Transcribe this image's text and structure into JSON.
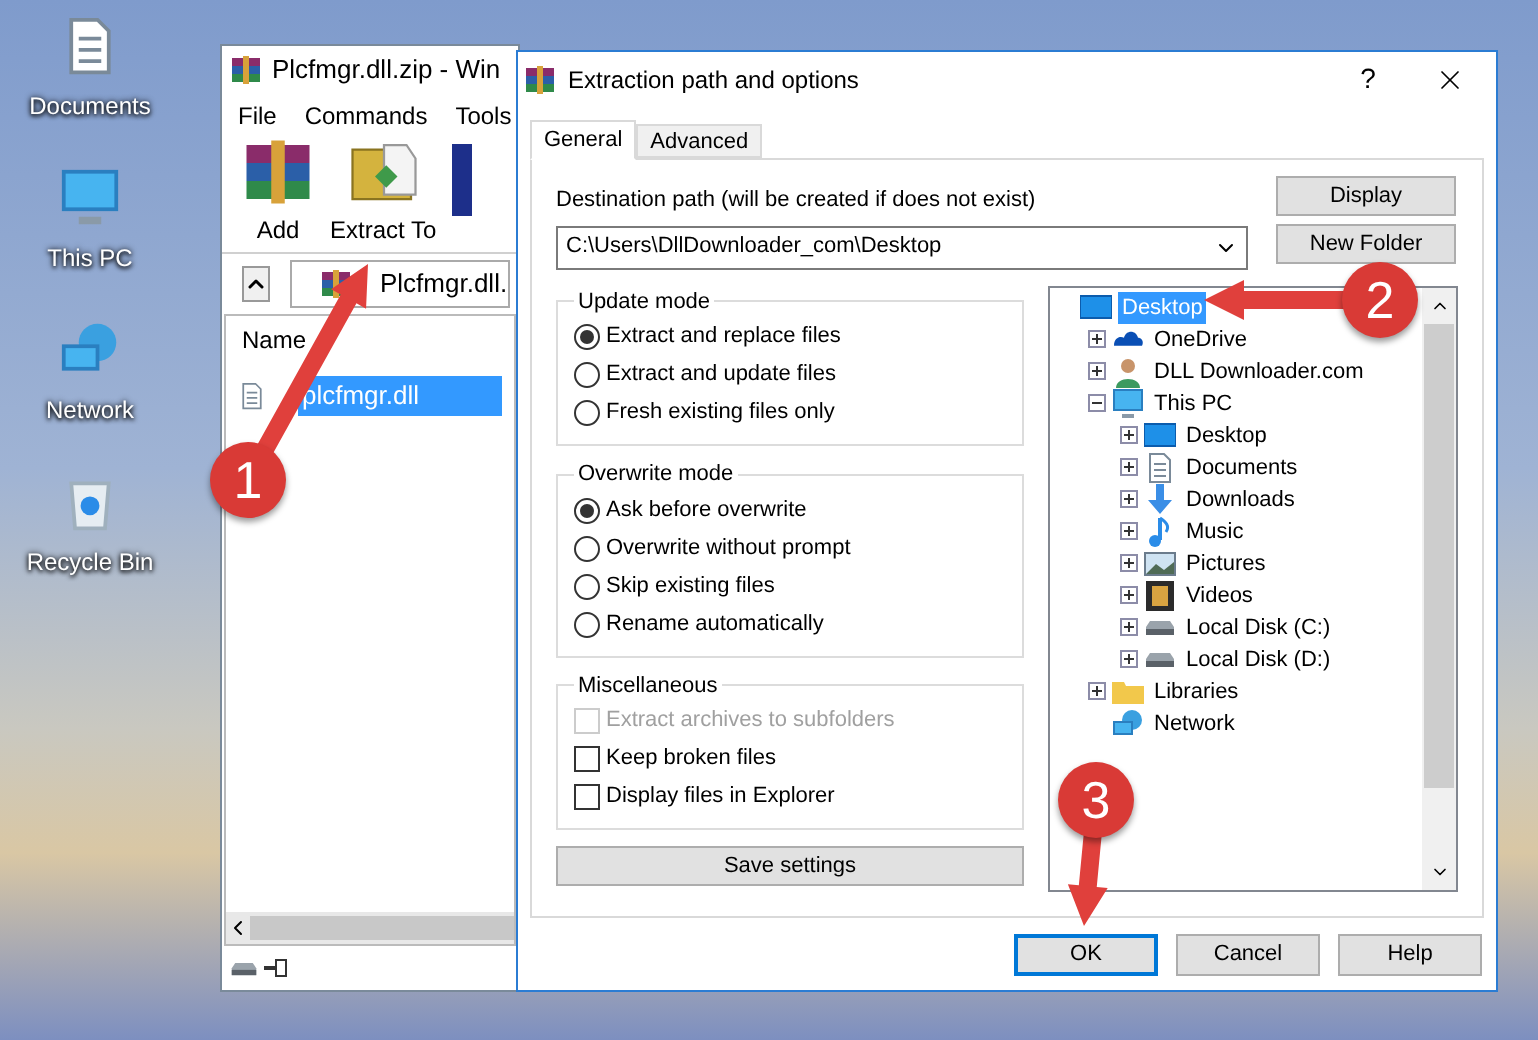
{
  "desktop_icons": [
    {
      "label": "Documents",
      "kind": "documents"
    },
    {
      "label": "This PC",
      "kind": "pc"
    },
    {
      "label": "Network",
      "kind": "network"
    },
    {
      "label": "Recycle Bin",
      "kind": "recycle"
    }
  ],
  "archive_window": {
    "title": "Plcfmgr.dll.zip - Win",
    "menu": [
      "File",
      "Commands",
      "Tools"
    ],
    "toolbar": [
      {
        "label": "Add",
        "kind": "add"
      },
      {
        "label": "Extract To",
        "kind": "extract"
      }
    ],
    "path": "Plcfmgr.dll.",
    "column": "Name",
    "files": [
      {
        "name": "plcfmgr.dll",
        "selected": true
      }
    ]
  },
  "dialog": {
    "title": "Extraction path and options",
    "help": "?",
    "tabs": [
      {
        "label": "General",
        "selected": true
      },
      {
        "label": "Advanced",
        "selected": false
      }
    ],
    "destination": {
      "label": "Destination path (will be created if does not exist)",
      "value": "C:\\Users\\DllDownloader_com\\Desktop"
    },
    "side_buttons": [
      "Display",
      "New Folder"
    ],
    "groups": [
      {
        "title": "Update mode",
        "kind": "radio",
        "options": [
          {
            "label": "Extract and replace files",
            "selected": true
          },
          {
            "label": "Extract and update files",
            "selected": false
          },
          {
            "label": "Fresh existing files only",
            "selected": false
          }
        ]
      },
      {
        "title": "Overwrite mode",
        "kind": "radio",
        "options": [
          {
            "label": "Ask before overwrite",
            "selected": true
          },
          {
            "label": "Overwrite without prompt",
            "selected": false
          },
          {
            "label": "Skip existing files",
            "selected": false
          },
          {
            "label": "Rename automatically",
            "selected": false
          }
        ]
      },
      {
        "title": "Miscellaneous",
        "kind": "check",
        "options": [
          {
            "label": "Extract archives to subfolders",
            "checked": false,
            "disabled": true
          },
          {
            "label": "Keep broken files",
            "checked": false,
            "disabled": false
          },
          {
            "label": "Display files in Explorer",
            "checked": false,
            "disabled": false
          }
        ]
      }
    ],
    "save_button": "Save settings",
    "tree": [
      {
        "label": "Desktop",
        "kind": "desktop",
        "selected": true,
        "children": [
          {
            "label": "OneDrive",
            "kind": "cloud",
            "selected": false,
            "expanded": false
          },
          {
            "label": "DLL Downloader.com",
            "kind": "user",
            "selected": false,
            "expanded": false
          },
          {
            "label": "This PC",
            "kind": "pc",
            "selected": false,
            "expanded": true,
            "children": [
              {
                "label": "Desktop",
                "kind": "desktop",
                "selected": false,
                "expanded": false
              },
              {
                "label": "Documents",
                "kind": "documents",
                "selected": false,
                "expanded": false
              },
              {
                "label": "Downloads",
                "kind": "download",
                "selected": false,
                "expanded": false
              },
              {
                "label": "Music",
                "kind": "music",
                "selected": false,
                "expanded": false
              },
              {
                "label": "Pictures",
                "kind": "pictures",
                "selected": false,
                "expanded": false
              },
              {
                "label": "Videos",
                "kind": "videos",
                "selected": false,
                "expanded": false
              },
              {
                "label": "Local Disk (C:)",
                "kind": "drive",
                "selected": false,
                "expanded": false
              },
              {
                "label": "Local Disk (D:)",
                "kind": "drive",
                "selected": false,
                "expanded": false
              }
            ]
          },
          {
            "label": "Libraries",
            "kind": "library",
            "selected": false,
            "expanded": false
          },
          {
            "label": "Network",
            "kind": "network",
            "selected": false
          }
        ]
      }
    ],
    "buttons": [
      {
        "label": "OK",
        "default": true
      },
      {
        "label": "Cancel",
        "default": false
      },
      {
        "label": "Help",
        "default": false
      }
    ]
  },
  "annotations": [
    {
      "label": "1"
    },
    {
      "label": "2"
    },
    {
      "label": "3"
    }
  ]
}
